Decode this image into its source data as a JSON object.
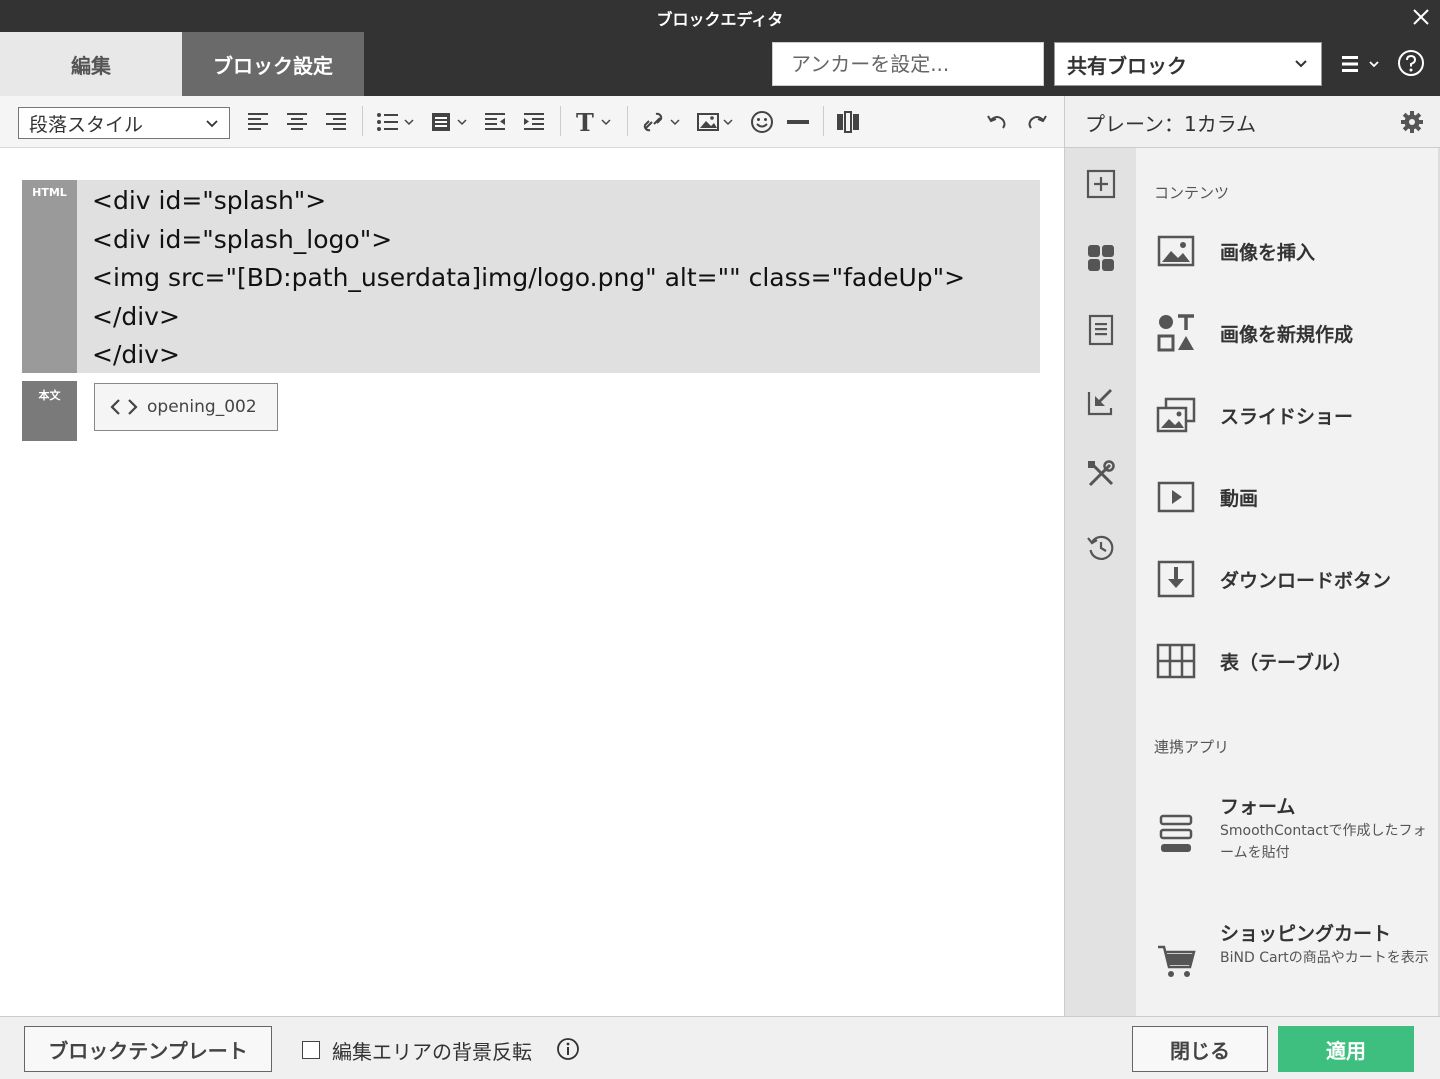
{
  "window": {
    "title": "ブロックエディタ"
  },
  "tabs": [
    {
      "label": "編集"
    },
    {
      "label": "ブロック設定"
    }
  ],
  "header": {
    "anchor_placeholder": "アンカーを設定...",
    "shared_block_label": "共有ブロック"
  },
  "toolbar": {
    "paragraph_style": "段落スタイル"
  },
  "editor": {
    "html_tag": "HTML",
    "code": "<div id=\"splash\">\n<div id=\"splash_logo\">\n<img src=\"[BD:path_userdata]img/logo.png\" alt=\"\" class=\"fadeUp\">\n</div>\n</div>",
    "body_tag": "本文",
    "part_label": "opening_002"
  },
  "panel": {
    "title": "プレーン：1カラム",
    "sections": [
      {
        "title": "コンテンツ",
        "items": [
          {
            "label": "画像を挿入",
            "icon": "image-icon"
          },
          {
            "label": "画像を新規作成",
            "icon": "shapes-icon"
          },
          {
            "label": "スライドショー",
            "icon": "slideshow-icon"
          },
          {
            "label": "動画",
            "icon": "video-icon"
          },
          {
            "label": "ダウンロードボタン",
            "icon": "download-icon"
          },
          {
            "label": "表（テーブル）",
            "icon": "table-icon"
          }
        ]
      },
      {
        "title": "連携アプリ",
        "items": [
          {
            "label": "フォーム",
            "desc": "SmoothContactで作成したフォームを貼付",
            "icon": "form-icon"
          },
          {
            "label": "ショッピングカート",
            "desc": "BiND Cartの商品やカートを表示",
            "icon": "cart-icon"
          }
        ]
      }
    ]
  },
  "footer": {
    "template_label": "ブロックテンプレート",
    "invert_label": "編集エリアの背景反転",
    "close_label": "閉じる",
    "apply_label": "適用"
  },
  "colors": {
    "dark": "#333333",
    "apply": "#3fbf7f",
    "code_bg": "#e0e0e0"
  }
}
